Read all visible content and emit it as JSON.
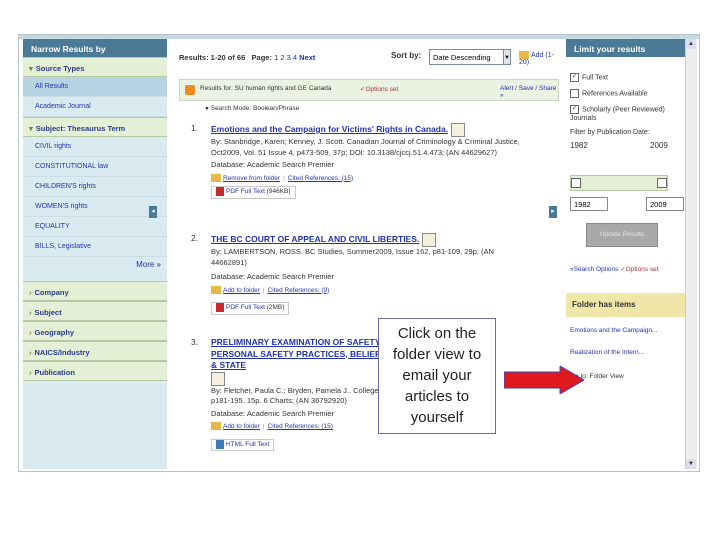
{
  "left": {
    "header": "Narrow Results by",
    "source_types_header": "Source Types",
    "source_types": [
      "All Results",
      "Academic Journal"
    ],
    "subject_header": "Subject: Thesaurus Term",
    "subjects": [
      "CIVIL rights",
      "CONSTITUTIONAL law",
      "CHILDREN'S rights",
      "WOMEN'S rights",
      "EQUALITY",
      "BILLS, Legislative"
    ],
    "more": "More »",
    "facets": [
      "Company",
      "Subject",
      "Geography",
      "NAICS/Industry",
      "Publication"
    ]
  },
  "results_bar": {
    "range": "Results: 1-20 of 66",
    "page_label": "Page:",
    "pages": [
      "1",
      "2",
      "3",
      "4"
    ],
    "next": "Next",
    "sort_label": "Sort by:",
    "sort_value": "Date Descending",
    "add_all": "Add (1-20)"
  },
  "rss": {
    "text": "Results for: SU human rights and GE Canada",
    "options": "✓Options set",
    "alert": "Alert / Save / Share »"
  },
  "search_mode": "● Search Mode: Boolean/Phrase",
  "results": [
    {
      "num": "1.",
      "title": "Emotions and the Campaign for Victims' Rights in Canada.",
      "line1": "By: Stanbridge, Karen; Kenney, J. Scott. Canadian Journal of Criminology & Criminal Justice,",
      "line2": "Oct2009, Vol. 51 Issue 4, p473-509, 37p; DOI: 10.3138/cjccj.51.4.473; (AN 44629627)",
      "db": "Database: Academic Search Premier",
      "folder": "Remove from folder",
      "refs": "Cited References: (15)",
      "ft": "PDF Full Text",
      "ft_size": "(946KB)"
    },
    {
      "num": "2.",
      "title": "THE BC COURT OF APPEAL AND CIVIL LIBERTIES.",
      "line1": "By: LAMBERTSON, ROSS. BC Studies, Summer2009, Issue 162, p81-109, 29p; (AN",
      "line2": "44662891)",
      "db": "Database: Academic Search Premier",
      "folder": "Add to folder",
      "refs": "Cited References: (9)",
      "ft": "PDF Full Text",
      "ft_size": "(2MB)"
    },
    {
      "num": "3.",
      "title": "PRELIMINARY EXAMINATION OF SAFETY ISSUES ... PERSONAL SAFETY PRACTICES, BELIEFS & AT ... Y & STATE",
      "line1": "By: Fletcher, Paula C.; Bryden, Pamela J.. College ...",
      "line2": "p181-195. 15p. 6 Charts; (AN 36792920)",
      "db": "Database: Academic Search Premier",
      "folder": "Add to folder",
      "refs": "Cited References: (15)",
      "ft": "HTML Full Text",
      "ft_size": ""
    }
  ],
  "callout": "Click on the folder view to email your articles to yourself",
  "right": {
    "header": "Limit your results",
    "full_text": "Full Text",
    "references": "References Available",
    "scholarly": "Scholarly (Peer Reviewed) Journals",
    "pub_date_label": "Filter by Publication Date:",
    "date_min": "1982",
    "date_max": "2009",
    "update": "Update Results",
    "search_options": "»Search Options",
    "options_set": "✓Options set",
    "folder_header": "Folder has items",
    "folder_items": [
      "Emotions and the Campaign...",
      "Realization of the Intern..."
    ],
    "folder_view": "Go to: Folder View"
  }
}
